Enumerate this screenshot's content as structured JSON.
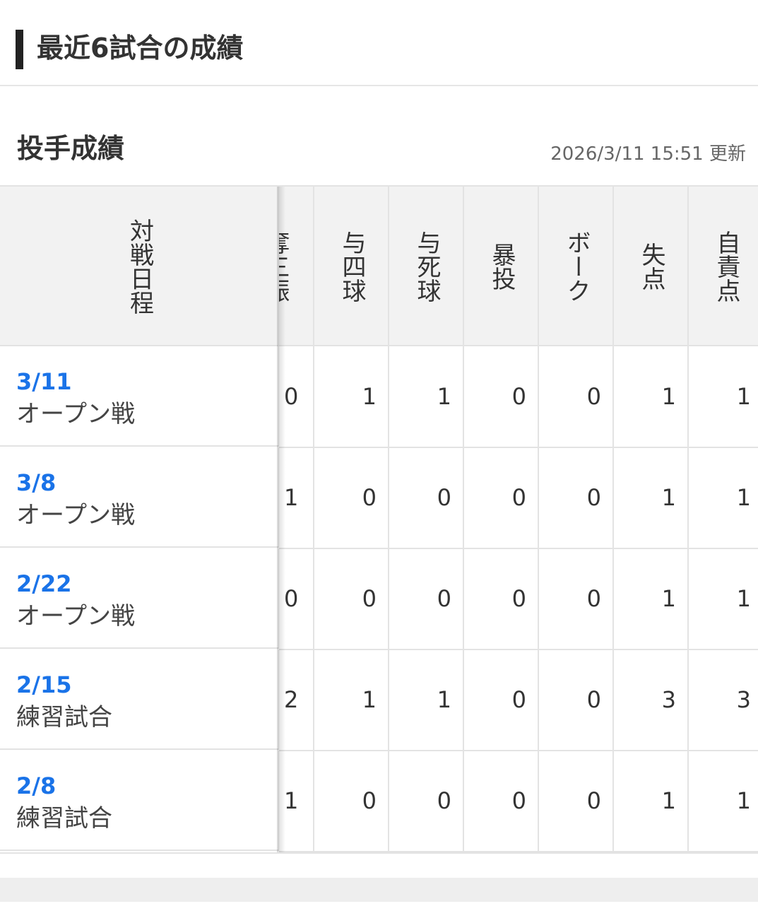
{
  "section": {
    "title": "最近6試合の成績"
  },
  "subsection": {
    "title": "投手成績",
    "updated": "2026/3/11 15:51 更新"
  },
  "table": {
    "fixed_header": "対戦日程",
    "columns": [
      "奪三振",
      "与四球",
      "与死球",
      "暴投",
      "ボーク",
      "失点",
      "自責点"
    ],
    "rows": [
      {
        "date": "3/11",
        "type": "オープン戦",
        "values": [
          "0",
          "1",
          "1",
          "0",
          "0",
          "1",
          "1"
        ]
      },
      {
        "date": "3/8",
        "type": "オープン戦",
        "values": [
          "1",
          "0",
          "0",
          "0",
          "0",
          "1",
          "1"
        ]
      },
      {
        "date": "2/22",
        "type": "オープン戦",
        "values": [
          "0",
          "0",
          "0",
          "0",
          "0",
          "1",
          "1"
        ]
      },
      {
        "date": "2/15",
        "type": "練習試合",
        "values": [
          "2",
          "1",
          "1",
          "0",
          "0",
          "3",
          "3"
        ]
      },
      {
        "date": "2/8",
        "type": "練習試合",
        "values": [
          "1",
          "0",
          "0",
          "0",
          "0",
          "1",
          "1"
        ]
      }
    ]
  }
}
